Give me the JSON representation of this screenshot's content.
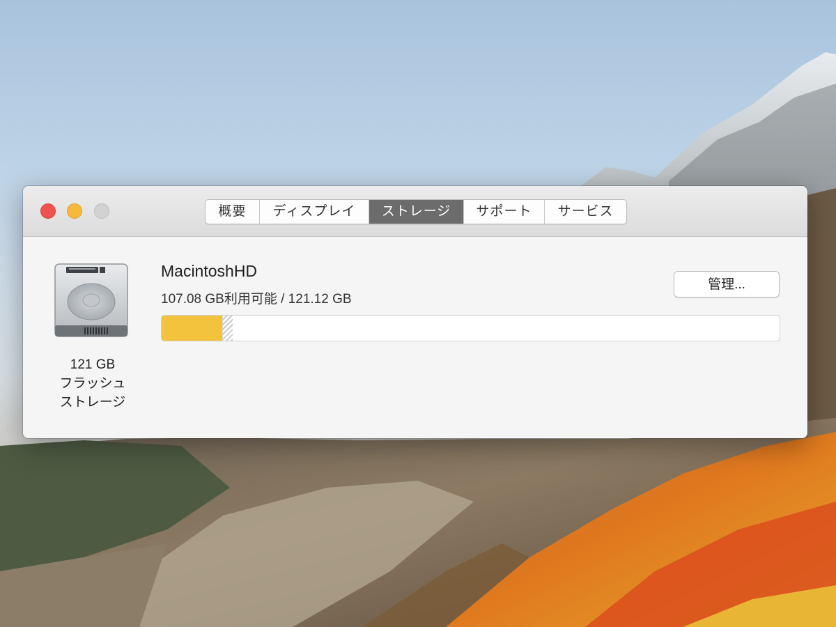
{
  "window": {
    "tabs": [
      {
        "label": "概要",
        "active": false
      },
      {
        "label": "ディスプレイ",
        "active": false
      },
      {
        "label": "ストレージ",
        "active": true
      },
      {
        "label": "サポート",
        "active": false
      },
      {
        "label": "サービス",
        "active": false
      }
    ]
  },
  "storage": {
    "volume_name": "MacintoshHD",
    "usage_text": "107.08 GB利用可能 / 121.12 GB",
    "manage_label": "管理...",
    "drive_caption": [
      "121 GB",
      "フラッシュ",
      "ストレージ"
    ],
    "available_gb": 107.08,
    "total_gb": 121.12,
    "used_fraction": 0.098,
    "purgeable_fraction": 0.016
  },
  "colors": {
    "used": "#f3c33d",
    "active_tab": "#6c6c6c",
    "close": "#f0524f",
    "minimize": "#f6b93a",
    "zoom": "#d2d2d2"
  },
  "icons": {
    "drive": "internal-drive-icon",
    "close": "close-icon",
    "minimize": "minimize-icon",
    "zoom": "zoom-icon"
  }
}
